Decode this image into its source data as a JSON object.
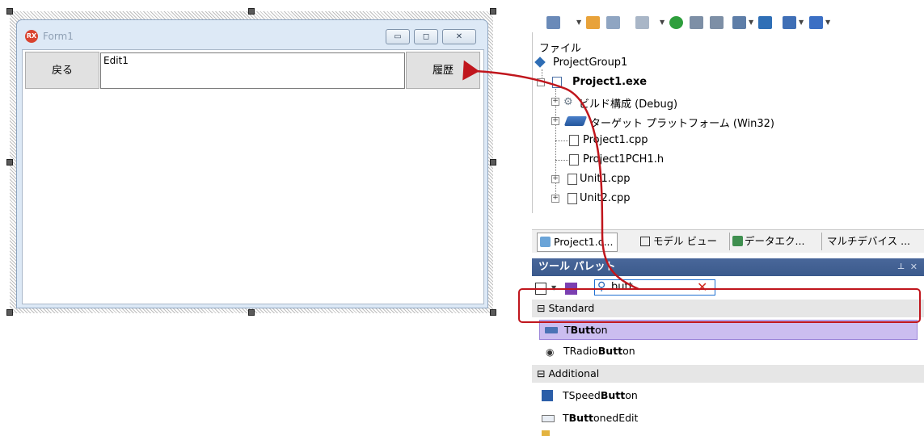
{
  "form": {
    "title": "Form1",
    "icon_label": "RX",
    "back_button": "戻る",
    "edit_text": "Edit1",
    "history_button": "履歴",
    "caption_buttons": [
      "minimize-icon",
      "maximize-icon",
      "close-icon"
    ]
  },
  "project_manager": {
    "header": "ファイル",
    "items": [
      {
        "label": "ProjectGroup1",
        "icon": "project-group-icon"
      },
      {
        "label": "Project1.exe",
        "icon": "project-exe-icon"
      },
      {
        "label": "ビルド構成 (Debug)",
        "icon": "gear-icon"
      },
      {
        "label": "ターゲット プラットフォーム (Win32)",
        "icon": "platform-icon"
      },
      {
        "label": "Project1.cpp",
        "icon": "cpp-file-icon"
      },
      {
        "label": "Project1PCH1.h",
        "icon": "header-file-icon"
      },
      {
        "label": "Unit1.cpp",
        "icon": "unit-file-icon"
      },
      {
        "label": "Unit2.cpp",
        "icon": "unit-file-icon"
      }
    ]
  },
  "tabs": [
    "Project1.c...",
    "モデル ビュー",
    "データエク...",
    "マルチデバイス ..."
  ],
  "palette": {
    "title": "ツール パレット",
    "search_value": "butt",
    "categories": [
      {
        "label": "Standard",
        "items": [
          {
            "pre": "T",
            "bold": "Butt",
            "post": "on",
            "icon": "button-icon"
          },
          {
            "pre": "TRadio",
            "bold": "Butt",
            "post": "on",
            "icon": "radio-button-icon"
          }
        ]
      },
      {
        "label": "Additional",
        "items": [
          {
            "pre": "TSpeed",
            "bold": "Butt",
            "post": "on",
            "icon": "speed-button-icon"
          },
          {
            "pre": "T",
            "bold": "Butt",
            "post": "onedEdit",
            "icon": "buttoned-edit-icon"
          }
        ]
      }
    ]
  },
  "colors": {
    "highlight": "#cbbdf0",
    "annotation_red": "#c0161d",
    "palette_header": "#3b5a8c"
  }
}
